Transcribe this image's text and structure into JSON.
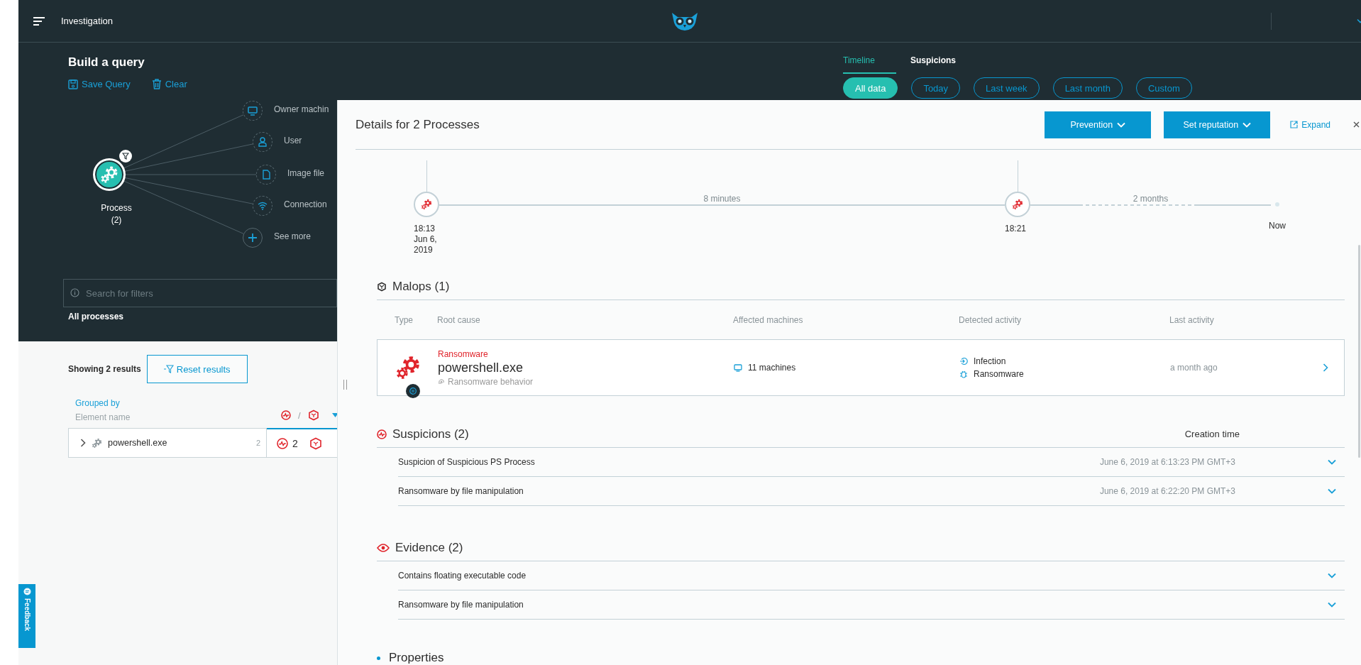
{
  "header": {
    "title": "Investigation"
  },
  "query": {
    "title": "Build a query",
    "actions": [
      {
        "label": "Save Query",
        "kind": "save"
      },
      {
        "label": "Clear",
        "kind": "clear"
      }
    ],
    "root": {
      "label": "Process",
      "count": "(2)",
      "filtered": true
    },
    "nodes": [
      {
        "label": "Owner machin",
        "kind": "machine"
      },
      {
        "label": "User",
        "kind": "user"
      },
      {
        "label": "Image file",
        "kind": "file"
      },
      {
        "label": "Connection",
        "kind": "connection"
      },
      {
        "label": "See more",
        "kind": "more"
      }
    ],
    "search": {
      "placeholder": "Search for filters"
    },
    "scope": "All processes"
  },
  "tabs": [
    {
      "label": "Timeline",
      "selected": true
    },
    {
      "label": "Suspicions",
      "selected": false
    }
  ],
  "ranges": [
    {
      "label": "All data",
      "selected": true
    },
    {
      "label": "Today",
      "selected": false
    },
    {
      "label": "Last week",
      "selected": false
    },
    {
      "label": "Last month",
      "selected": false
    },
    {
      "label": "Custom",
      "selected": false
    }
  ],
  "results": {
    "summary": "Showing 2 results",
    "reset": "Reset results",
    "grouped_by": "Grouped by",
    "group_field": "Element name",
    "sort_separator": "/",
    "rows": [
      {
        "name": "powershell.exe",
        "count": "2",
        "suspicions": "2",
        "expanded": false
      }
    ]
  },
  "feedback": "Feedback",
  "details": {
    "title": "Details for 2 Processes",
    "buttons": [
      "Prevention",
      "Set reputation"
    ],
    "expand": "Expand",
    "timeline": {
      "events": [
        {
          "lines": [
            "18:13",
            "Jun 6,",
            "2019"
          ]
        },
        {
          "lines": [
            "18:21"
          ]
        }
      ],
      "gaps": [
        {
          "label": "8 minutes",
          "dashed": false
        },
        {
          "label": "2 months",
          "dashed": true
        }
      ],
      "end": "Now"
    },
    "malops": {
      "title": "Malops (1)",
      "columns": [
        "Type",
        "Root cause",
        "Affected machines",
        "Detected activity",
        "Last activity"
      ],
      "rows": [
        {
          "type": "Ransomware",
          "root_cause": "powershell.exe",
          "description": "Ransomware behavior",
          "machines": "11 machines",
          "activities": [
            {
              "label": "Infection",
              "kind": "infection"
            },
            {
              "label": "Ransomware",
              "kind": "ransomware"
            }
          ],
          "last_activity": "a month ago"
        }
      ]
    },
    "suspicions": {
      "title": "Suspicions (2)",
      "column": "Creation time",
      "rows": [
        {
          "name": "Suspicion of Suspicious PS Process",
          "time": "June 6, 2019 at 6:13:23 PM GMT+3"
        },
        {
          "name": "Ransomware by file manipulation",
          "time": "June 6, 2019 at 6:22:20 PM GMT+3"
        }
      ]
    },
    "evidence": {
      "title": "Evidence (2)",
      "rows": [
        {
          "name": "Contains floating executable code"
        },
        {
          "name": "Ransomware by file manipulation"
        }
      ]
    },
    "properties": {
      "title": "Properties"
    }
  }
}
